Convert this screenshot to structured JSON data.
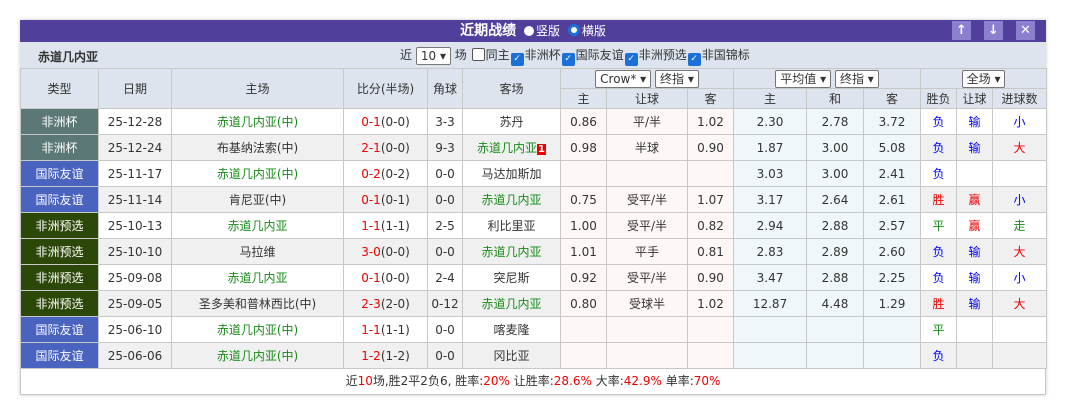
{
  "title": "近期战绩",
  "layout_options": [
    "竖版",
    "横版"
  ],
  "layout_selected": "横版",
  "buttons": {
    "up": "↑",
    "down": "↓",
    "close": "✕"
  },
  "team": "赤道几内亚",
  "filter": {
    "prefix": "近",
    "count": "10",
    "suffix": "场",
    "same_home": "同主",
    "same_home_checked": false,
    "competitions": [
      {
        "label": "非洲杯",
        "checked": true
      },
      {
        "label": "国际友谊",
        "checked": true
      },
      {
        "label": "非洲预选",
        "checked": true
      },
      {
        "label": "非国锦标",
        "checked": true
      }
    ]
  },
  "selects": {
    "company": "Crow*",
    "odds_type1": "终指",
    "avg": "平均值",
    "odds_type2": "终指",
    "period": "全场"
  },
  "headers": {
    "type": "类型",
    "date": "日期",
    "home": "主场",
    "score": "比分(半场)",
    "corner": "角球",
    "away": "客场",
    "ah_home": "主",
    "ah_line": "让球",
    "ah_away": "客",
    "eu_home": "主",
    "eu_draw": "和",
    "eu_away": "客",
    "result": "胜负",
    "handicap": "让球",
    "goals": "进球数"
  },
  "colors": {
    "非洲杯": "#5b7876",
    "国际友谊": "#4a63bf",
    "非洲预选": "#2c4808",
    "title_bar": "#513f9b"
  },
  "rows": [
    {
      "type": "非洲杯",
      "date": "25-12-28",
      "home": "赤道几内亚(中)",
      "home_hl": true,
      "ft": "0-1",
      "ht": "(0-0)",
      "corner": "3-3",
      "away": "苏丹",
      "away_hl": false,
      "ah": [
        "0.86",
        "平/半",
        "1.02"
      ],
      "eu": [
        "2.30",
        "2.78",
        "3.72"
      ],
      "res": "负",
      "hc": "输",
      "gl": "小"
    },
    {
      "type": "非洲杯",
      "date": "25-12-24",
      "home": "布基纳法索(中)",
      "home_hl": false,
      "ft": "2-1",
      "ht": "(0-0)",
      "corner": "9-3",
      "away": "赤道几内亚",
      "away_hl": true,
      "red_card": "1",
      "ah": [
        "0.98",
        "半球",
        "0.90"
      ],
      "eu": [
        "1.87",
        "3.00",
        "5.08"
      ],
      "res": "负",
      "hc": "输",
      "gl": "大"
    },
    {
      "type": "国际友谊",
      "date": "25-11-17",
      "home": "赤道几内亚(中)",
      "home_hl": true,
      "ft": "0-2",
      "ht": "(0-2)",
      "corner": "0-0",
      "away": "马达加斯加",
      "away_hl": false,
      "ah": [
        "",
        "",
        ""
      ],
      "eu": [
        "3.03",
        "3.00",
        "2.41"
      ],
      "res": "负",
      "hc": "",
      "gl": ""
    },
    {
      "type": "国际友谊",
      "date": "25-11-14",
      "home": "肯尼亚(中)",
      "home_hl": false,
      "ft": "0-1",
      "ht": "(0-1)",
      "corner": "0-0",
      "away": "赤道几内亚",
      "away_hl": true,
      "ah": [
        "0.75",
        "受平/半",
        "1.07"
      ],
      "eu": [
        "3.17",
        "2.64",
        "2.61"
      ],
      "res": "胜",
      "hc": "赢",
      "gl": "小"
    },
    {
      "type": "非洲预选",
      "date": "25-10-13",
      "home": "赤道几内亚",
      "home_hl": true,
      "ft": "1-1",
      "ht": "(1-1)",
      "corner": "2-5",
      "away": "利比里亚",
      "away_hl": false,
      "ah": [
        "1.00",
        "受平/半",
        "0.82"
      ],
      "eu": [
        "2.94",
        "2.88",
        "2.57"
      ],
      "res": "平",
      "hc": "赢",
      "gl": "走"
    },
    {
      "type": "非洲预选",
      "date": "25-10-10",
      "home": "马拉维",
      "home_hl": false,
      "ft": "3-0",
      "ht": "(0-0)",
      "corner": "0-0",
      "away": "赤道几内亚",
      "away_hl": true,
      "ah": [
        "1.01",
        "平手",
        "0.81"
      ],
      "eu": [
        "2.83",
        "2.89",
        "2.60"
      ],
      "res": "负",
      "hc": "输",
      "gl": "大"
    },
    {
      "type": "非洲预选",
      "date": "25-09-08",
      "home": "赤道几内亚",
      "home_hl": true,
      "ft": "0-1",
      "ht": "(0-0)",
      "corner": "2-4",
      "away": "突尼斯",
      "away_hl": false,
      "ah": [
        "0.92",
        "受平/半",
        "0.90"
      ],
      "eu": [
        "3.47",
        "2.88",
        "2.25"
      ],
      "res": "负",
      "hc": "输",
      "gl": "小"
    },
    {
      "type": "非洲预选",
      "date": "25-09-05",
      "home": "圣多美和普林西比(中)",
      "home_hl": false,
      "ft": "2-3",
      "ht": "(2-0)",
      "corner": "0-12",
      "away": "赤道几内亚",
      "away_hl": true,
      "ah": [
        "0.80",
        "受球半",
        "1.02"
      ],
      "eu": [
        "12.87",
        "4.48",
        "1.29"
      ],
      "res": "胜",
      "hc": "输",
      "gl": "大"
    },
    {
      "type": "国际友谊",
      "date": "25-06-10",
      "home": "赤道几内亚(中)",
      "home_hl": true,
      "ft": "1-1",
      "ht": "(1-1)",
      "corner": "0-0",
      "away": "喀麦隆",
      "away_hl": false,
      "ah": [
        "",
        "",
        ""
      ],
      "eu": [
        "",
        "",
        ""
      ],
      "res": "平",
      "hc": "",
      "gl": ""
    },
    {
      "type": "国际友谊",
      "date": "25-06-06",
      "home": "赤道几内亚(中)",
      "home_hl": true,
      "ft": "1-2",
      "ht": "(1-2)",
      "corner": "0-0",
      "away": "冈比亚",
      "away_hl": false,
      "ah": [
        "",
        "",
        ""
      ],
      "eu": [
        "",
        "",
        ""
      ],
      "res": "负",
      "hc": "",
      "gl": ""
    }
  ],
  "summary": [
    {
      "t": "近",
      "c": ""
    },
    {
      "t": "10",
      "c": "red"
    },
    {
      "t": "场,胜2平2负6, 胜率:",
      "c": ""
    },
    {
      "t": "20%",
      "c": "red"
    },
    {
      "t": " 让胜率:",
      "c": ""
    },
    {
      "t": "28.6%",
      "c": "red"
    },
    {
      "t": " 大率:",
      "c": ""
    },
    {
      "t": "42.9%",
      "c": "red"
    },
    {
      "t": " 单率:",
      "c": ""
    },
    {
      "t": "70%",
      "c": "red"
    }
  ]
}
